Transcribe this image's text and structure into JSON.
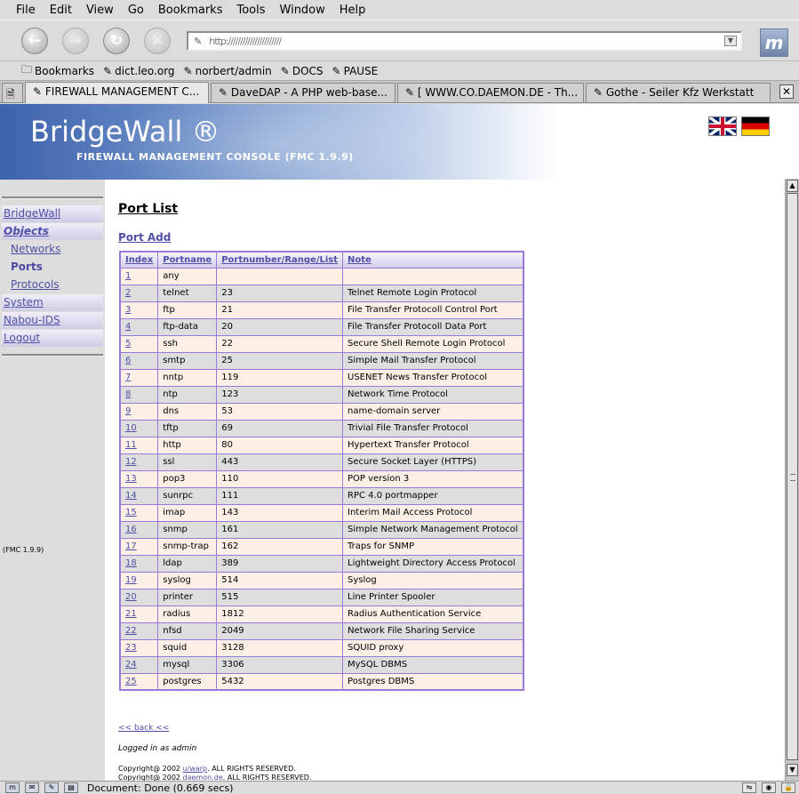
{
  "browser": {
    "menus": [
      "File",
      "Edit",
      "View",
      "Go",
      "Bookmarks",
      "Tools",
      "Window",
      "Help"
    ],
    "bookmarks": [
      "Bookmarks",
      "dict.leo.org",
      "norbert/admin",
      "DOCS",
      "PAUSE"
    ],
    "tabs": [
      "FIREWALL MANAGEMENT C...",
      "DaveDAP - A PHP web-base...",
      "[ WWW.CO.DAEMON.DE - Th...",
      "Gothe - Seiler Kfz Werkstatt"
    ],
    "url": "http://////////////////////",
    "status": "Document: Done (0.669 secs)",
    "logo_text": "m"
  },
  "banner": {
    "title": "BridgeWall ®",
    "subtitle": "FIREWALL MANAGEMENT CONSOLE (FMC 1.9.9)"
  },
  "sidebar": {
    "items": [
      "BridgeWall",
      "Objects",
      "Networks",
      "Ports",
      "Protocols",
      "System",
      "Nabou-IDS",
      "Logout"
    ],
    "version": "(FMC 1.9.9)"
  },
  "main": {
    "title": "Port List",
    "add_link": "Port Add",
    "columns": [
      "Index",
      "Portname",
      "Portnumber/Range/List",
      "Note"
    ],
    "rows": [
      [
        "1",
        "any",
        "",
        ""
      ],
      [
        "2",
        "telnet",
        "23",
        "Telnet Remote Login Protocol"
      ],
      [
        "3",
        "ftp",
        "21",
        "File Transfer Protocoll Control Port"
      ],
      [
        "4",
        "ftp-data",
        "20",
        "File Transfer Protocoll Data Port"
      ],
      [
        "5",
        "ssh",
        "22",
        "Secure Shell Remote Login Protocol"
      ],
      [
        "6",
        "smtp",
        "25",
        "Simple Mail Transfer Protocol"
      ],
      [
        "7",
        "nntp",
        "119",
        "USENET News Transfer Protocol"
      ],
      [
        "8",
        "ntp",
        "123",
        "Network Time Protocol"
      ],
      [
        "9",
        "dns",
        "53",
        "name-domain server"
      ],
      [
        "10",
        "tftp",
        "69",
        "Trivial File Transfer Protocol"
      ],
      [
        "11",
        "http",
        "80",
        "Hypertext Transfer Protocol"
      ],
      [
        "12",
        "ssl",
        "443",
        "Secure Socket Layer (HTTPS)"
      ],
      [
        "13",
        "pop3",
        "110",
        "POP version 3"
      ],
      [
        "14",
        "sunrpc",
        "111",
        "RPC 4.0 portmapper"
      ],
      [
        "15",
        "imap",
        "143",
        "Interim Mail Access Protocol"
      ],
      [
        "16",
        "snmp",
        "161",
        "Simple Network Management Protocol"
      ],
      [
        "17",
        "snmp-trap",
        "162",
        "Traps for SNMP"
      ],
      [
        "18",
        "ldap",
        "389",
        "Lightweight Directory Access Protocol"
      ],
      [
        "19",
        "syslog",
        "514",
        "Syslog"
      ],
      [
        "20",
        "printer",
        "515",
        "Line Printer Spooler"
      ],
      [
        "21",
        "radius",
        "1812",
        "Radius Authentication Service"
      ],
      [
        "22",
        "nfsd",
        "2049",
        "Network File Sharing Service"
      ],
      [
        "23",
        "squid",
        "3128",
        "SQUID proxy"
      ],
      [
        "24",
        "mysql",
        "3306",
        "MySQL DBMS"
      ],
      [
        "25",
        "postgres",
        "5432",
        "Postgres DBMS"
      ]
    ],
    "back_link": "<< back <<",
    "logged_in": "Logged in as admin",
    "copyright1_prefix": "Copyright@ 2002 ",
    "copyright1_link": "u/warp",
    "copyright1_suffix": ". ALL RIGHTS RESERVED.",
    "copyright2_prefix": "Copyright@ 2002 ",
    "copyright2_link": "daemon.de",
    "copyright2_suffix": ". ALL RIGHTS RESERVED."
  },
  "colors": {
    "link": "#5050a8",
    "table_border": "#9a7ad6",
    "row_odd": "#fcefe6",
    "row_even": "#dedede"
  }
}
